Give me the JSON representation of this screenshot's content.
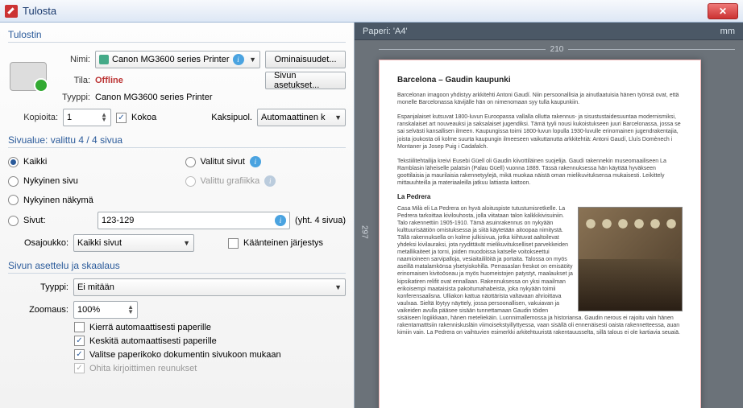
{
  "window": {
    "title": "Tulosta"
  },
  "printer": {
    "section": "Tulostin",
    "name_label": "Nimi:",
    "name_value": "Canon MG3600 series Printer",
    "status_label": "Tila:",
    "status_value": "Offline",
    "type_label": "Tyyppi:",
    "type_value": "Canon MG3600 series Printer",
    "copies_label": "Kopioita:",
    "copies_value": "1",
    "collate_label": "Kokoa",
    "duplex_label": "Kaksipuol.",
    "duplex_value": "Automaattinen k",
    "properties_btn": "Ominaisuudet...",
    "pagesetup_btn": "Sivun asetukset..."
  },
  "range": {
    "section": "Sivualue: valittu 4 / 4 sivua",
    "all": "Kaikki",
    "current_page": "Nykyinen sivu",
    "current_view": "Nykyinen näkymä",
    "pages_label": "Sivut:",
    "pages_value": "123-129",
    "pages_total": "(yht. 4 sivua)",
    "selected_pages": "Valitut sivut",
    "selected_graphic": "Valittu grafiikka",
    "subset_label": "Osajoukko:",
    "subset_value": "Kaikki sivut",
    "reverse_label": "Käänteinen järjestys"
  },
  "scaling": {
    "section": "Sivun asettelu ja skaalaus",
    "type_label": "Tyyppi:",
    "type_value": "Ei mitään",
    "zoom_label": "Zoomaus:",
    "zoom_value": "100%",
    "auto_rotate": "Kierrä automaattisesti paperille",
    "auto_center": "Keskitä automaattisesti paperille",
    "choose_paper": "Valitse paperikoko dokumentin sivukoon mukaan",
    "ignore_margins": "Ohita kirjoittimen reunukset"
  },
  "preview": {
    "paper_label": "Paperi: 'A4'",
    "mm": "mm",
    "width_mm": "210",
    "height_mm": "297",
    "doc": {
      "title": "Barcelona – Gaudin kaupunki",
      "p1": "Barcelonan imagoon yhdistyy arkkitehti Antoni Gaudí. Niin persoonallisia ja ainutlaatuisia hänen työnsä ovat, että monelle Barcelonassa kävijälle hän on nimenomaan syy tulla kaupunkiin.",
      "p2": "Espanjalaiset kutsuvat 1800-luvun Euroopassa vallalla ollutta rakennus- ja sisustustaidesuuntaa modernismiksi, ranskalaiset art nouveauksi ja saksalaiset jugendiksi. Tämä tyyli nousi kukoistukseen juuri Barcelonassa, jossa se sai selvästi kansallisen ilmeen. Kaupungissa toimi 1800-luvun lopulla 1930-luvulle erinomainen jugendrakentajia, joista joukosta oli kolme suurta kaupungin ilmeeseen vaikuttanutta arkkitehtiä: Antoni Gaudí, Lluís Domènech i Montaner ja Josep Puig i Cadafalch.",
      "p3": "Tekstiilitehtailija kreivi Eusebi Güell oli Gaudin kiivottiläinen suojelija. Gaudi rakennekin museomaailiseen La Ramblasin läheiselle palatsin (Palau Güell) vuonna 1889. Tässä rakennuksessa hän käyttää hyväkseen goottilaisia ja maurilaisia rakennetyylejä, mikä muokaa näistä oman mielikuvituksensa mukaisesti. Leikittely mittauuhteilla ja materiaaleilla jatkuu lattiasta kattoon.",
      "h2": "La Pedrera",
      "p4": "Casa Milà eli La Pedrera on hyvä aloituspiste tutustumisretkelle. La Pedrera tarkoittaa kivilouhosta, jolla viitataan talon kalkkikivisuiniin. Talo rakennettiin 1905-1910. Tämä asuinrakennus on nykyään kulttuurisäätiön omistuksessa ja siitä käytetään aitoopaa nimitystä. Tällä rakennuksella on kolme julkisivua, jotka kiihtuvat aaltoilevat yhdeksi kivilauraksi, jota ryydittävät mielikuvitukselliset parvekkeiden metallikaiteet ja torni, joiden muodoissa katselle voitokseettui naamioineen sarvipalloja, vesiaitaililöitä ja portaita. Talossa on myös aseillä matalamkönsa ylsetyiskohilla. Perrasaslan freskot on emisäöity erinomaisen kivitoöseau ja myös huomeistojen patystyt, maalaukset ja kipsikatiren relifit ovat ennallaan. Rakennuksessa on yksi maailman erikoisempi maataisista pakoitumahabeista, joka nykyään toimii konferensaalisna. Ulliakon kattua näottärista valtavaan ahrioittava vaulxaa. Sieltä löytyy näyttely, jossa persoonallisen, vakuiavan ja vaikeiden avulla pääsee sisään tunnettamaan Gaudin töiden sisäiseen logiikkaan, hänen meteliekäin. Luonnimallemossa ja historiansa. Gaudin nerous ei rajoitu vain hänen rakentamatttsiin rakenniskusläin viimoisekstyillyttyessa, vaan sisällä oli ennenäisesti oaista rakennetteessa, auan kimiin vain. La Pedrera on vaihtuvien esimerkki arkitehtuuristä rakentauusselta, sillä talous ei ole kartiavia seuaiä."
    }
  }
}
